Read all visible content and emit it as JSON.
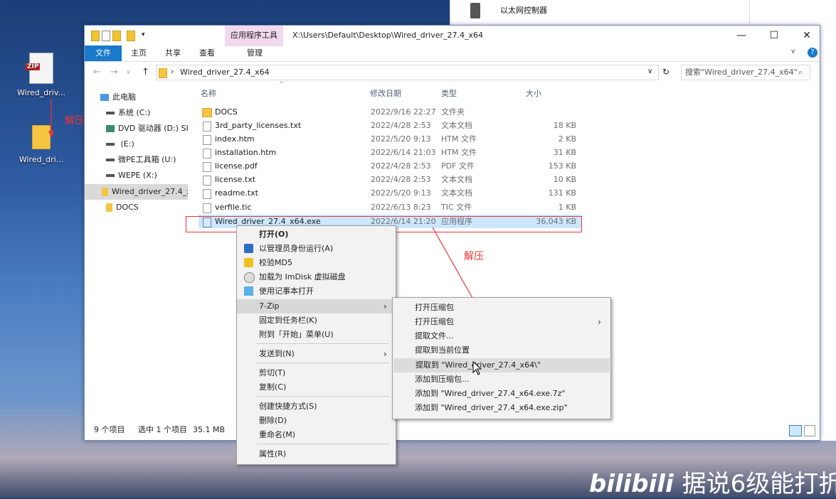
{
  "background_window": {
    "item": "以太网控制器"
  },
  "desktop": {
    "icons": [
      {
        "label": "Wired_driv...",
        "icon": "zip-file-icon",
        "badge": "ZIP"
      },
      {
        "label": "Wired_dri...",
        "icon": "folder-icon"
      }
    ],
    "annotation_left": "解压",
    "annotation_right": "解压"
  },
  "window": {
    "tool_tab": "应用程序工具",
    "title": "X:\\Users\\Default\\Desktop\\Wired_driver_27.4_x64",
    "controls": {
      "minimize": "—",
      "maximize": "☐",
      "close": "✕"
    },
    "ribbon_tabs": [
      "文件",
      "主页",
      "共享",
      "查看",
      "管理"
    ],
    "address": {
      "path": "Wired_driver_27.4_x64",
      "search_placeholder": "搜索\"Wired_driver_27.4_x64\""
    },
    "nav": [
      {
        "label": "此电脑",
        "icon": "computer-icon"
      },
      {
        "label": "系统 (C:)",
        "icon": "drive-icon"
      },
      {
        "label": "DVD 驱动器 (D:) SI",
        "icon": "dvd-icon"
      },
      {
        "label": " (E:)",
        "icon": "drive-icon"
      },
      {
        "label": "微PE工具箱 (U:)",
        "icon": "drive-icon"
      },
      {
        "label": "WEPE (X:)",
        "icon": "drive-icon"
      },
      {
        "label": "Wired_driver_27.4_x",
        "icon": "folder-icon"
      },
      {
        "label": "DOCS",
        "icon": "folder-icon"
      }
    ],
    "columns": {
      "name": "名称",
      "date": "修改日期",
      "type": "类型",
      "size": "大小"
    },
    "files": [
      {
        "name": "DOCS",
        "date": "2022/9/16 22:27",
        "type": "文件夹",
        "size": "",
        "kind": "folder"
      },
      {
        "name": "3rd_party_licenses.txt",
        "date": "2022/4/28 2:53",
        "type": "文本文档",
        "size": "18 KB",
        "kind": "file"
      },
      {
        "name": "index.htm",
        "date": "2022/5/20 9:13",
        "type": "HTM 文件",
        "size": "2 KB",
        "kind": "file"
      },
      {
        "name": "installation.htm",
        "date": "2022/6/14 21:03",
        "type": "HTM 文件",
        "size": "31 KB",
        "kind": "file"
      },
      {
        "name": "license.pdf",
        "date": "2022/4/28 2:53",
        "type": "PDF 文件",
        "size": "153 KB",
        "kind": "file"
      },
      {
        "name": "license.txt",
        "date": "2022/4/28 2:53",
        "type": "文本文档",
        "size": "10 KB",
        "kind": "file"
      },
      {
        "name": "readme.txt",
        "date": "2022/5/20 9:13",
        "type": "文本文档",
        "size": "131 KB",
        "kind": "file"
      },
      {
        "name": "verfile.tic",
        "date": "2022/6/13 8:23",
        "type": "TIC 文件",
        "size": "1 KB",
        "kind": "file"
      },
      {
        "name": "Wired_driver_27.4_x64.exe",
        "date": "2022/6/14 21:20",
        "type": "应用程序",
        "size": "36,043 KB",
        "kind": "exe"
      }
    ],
    "status": {
      "count": "9 个项目",
      "selected": "选中 1 个项目",
      "size": "35.1 MB"
    }
  },
  "context_menu": [
    {
      "label": "打开(O)",
      "bold": true
    },
    {
      "label": "以管理员身份运行(A)",
      "icon": "shield-icon"
    },
    {
      "label": "校验MD5",
      "icon": "warning-shield-icon"
    },
    {
      "label": "加载为 ImDisk 虚拟磁盘",
      "icon": "disk-icon"
    },
    {
      "label": "使用记事本打开",
      "icon": "notepad-icon"
    },
    {
      "label": "7-Zip",
      "submenu": true,
      "hover": true
    },
    {
      "label": "固定到任务栏(K)"
    },
    {
      "label": "附到「开始」菜单(U)"
    },
    {
      "label": "发送到(N)",
      "submenu": true
    },
    {
      "label": "剪切(T)"
    },
    {
      "label": "复制(C)"
    },
    {
      "label": "创建快捷方式(S)"
    },
    {
      "label": "删除(D)"
    },
    {
      "label": "重命名(M)"
    },
    {
      "label": "属性(R)"
    }
  ],
  "zip_menu": [
    {
      "label": "打开压缩包"
    },
    {
      "label": "打开压缩包",
      "submenu": true
    },
    {
      "label": "提取文件..."
    },
    {
      "label": "提取到当前位置"
    },
    {
      "label": "提取到 \"Wired_driver_27.4_x64\\\"",
      "hover": true
    },
    {
      "label": "添加到压缩包..."
    },
    {
      "label": "添加到 \"Wired_driver_27.4_x64.exe.7z\""
    },
    {
      "label": "添加到 \"Wired_driver_27.4_x64.exe.zip\""
    }
  ],
  "watermark": {
    "logo": "bilibili",
    "text": "据说6级能打折"
  },
  "colors": {
    "accent": "#1979ca",
    "selection": "#cce8ff",
    "annotation": "#e33333",
    "tool_tab": "#f3d9ee"
  }
}
